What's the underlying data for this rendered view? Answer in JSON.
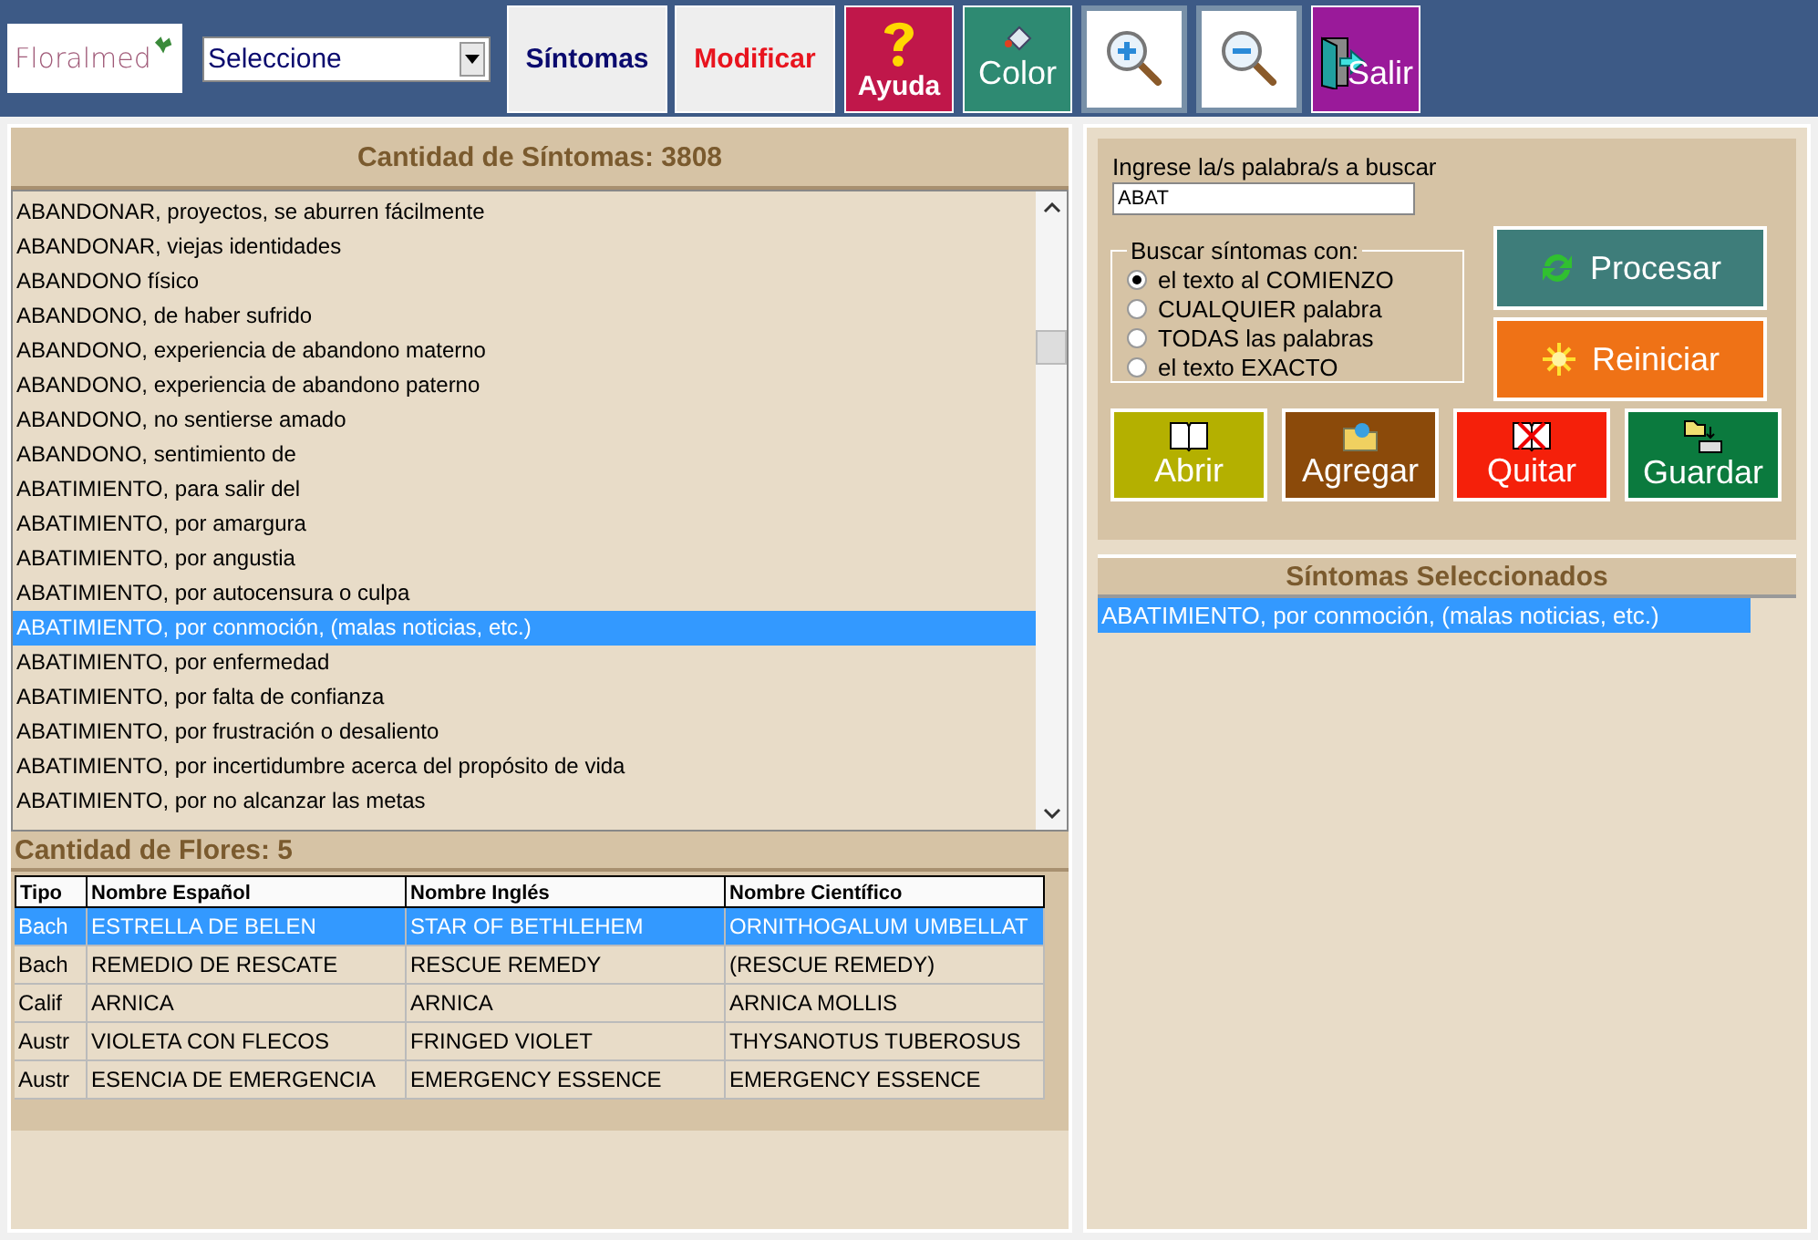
{
  "toolbar": {
    "logo": "Floralmed",
    "select": {
      "value": "Seleccione"
    },
    "buttons": [
      {
        "kind": "text",
        "label": "Síntomas",
        "color": "#0a0a6e"
      },
      {
        "kind": "text",
        "label": "Modificar",
        "color": "#e8141e"
      },
      {
        "kind": "help",
        "label": "Ayuda",
        "color": "#c0174a"
      },
      {
        "kind": "color",
        "label": "Color",
        "color": "#2e8a72"
      },
      {
        "kind": "zoom-in"
      },
      {
        "kind": "zoom-out"
      },
      {
        "kind": "exit",
        "label": "Salir",
        "color": "#9a1a9a"
      }
    ]
  },
  "symptoms": {
    "title": "Cantidad de Síntomas: 3808",
    "items": [
      {
        "text": "ABANDONAR, proyectos, se aburren fácilmente",
        "selected": false
      },
      {
        "text": "ABANDONAR, viejas identidades",
        "selected": false
      },
      {
        "text": "ABANDONO físico",
        "selected": false
      },
      {
        "text": "ABANDONO, de haber sufrido",
        "selected": false
      },
      {
        "text": "ABANDONO, experiencia de abandono materno",
        "selected": false
      },
      {
        "text": "ABANDONO, experiencia de abandono paterno",
        "selected": false
      },
      {
        "text": "ABANDONO, no sentierse amado",
        "selected": false
      },
      {
        "text": "ABANDONO, sentimiento de",
        "selected": false
      },
      {
        "text": "ABATIMIENTO, para salir del",
        "selected": false
      },
      {
        "text": "ABATIMIENTO, por amargura",
        "selected": false
      },
      {
        "text": "ABATIMIENTO, por angustia",
        "selected": false
      },
      {
        "text": "ABATIMIENTO, por autocensura o culpa",
        "selected": false
      },
      {
        "text": "ABATIMIENTO, por conmoción, (malas noticias, etc.)",
        "selected": true
      },
      {
        "text": "ABATIMIENTO, por enfermedad",
        "selected": false
      },
      {
        "text": "ABATIMIENTO, por falta de confianza",
        "selected": false
      },
      {
        "text": "ABATIMIENTO, por frustración o desaliento",
        "selected": false
      },
      {
        "text": "ABATIMIENTO, por incertidumbre acerca del propósito de vida",
        "selected": false
      },
      {
        "text": "ABATIMIENTO, por no alcanzar las metas",
        "selected": false
      }
    ]
  },
  "flowers": {
    "title": "Cantidad de Flores: 5",
    "columns": [
      "Tipo",
      "Nombre Español",
      "Nombre Inglés",
      "Nombre Científico"
    ],
    "rows": [
      {
        "cells": [
          "Bach",
          "ESTRELLA DE BELEN",
          "STAR OF BETHLEHEM",
          "ORNITHOGALUM UMBELLAT"
        ],
        "selected": true
      },
      {
        "cells": [
          "Bach",
          "REMEDIO DE RESCATE",
          "RESCUE REMEDY",
          "(RESCUE REMEDY)"
        ],
        "selected": false
      },
      {
        "cells": [
          "Calif",
          "ARNICA",
          "ARNICA",
          "ARNICA MOLLIS"
        ],
        "selected": false
      },
      {
        "cells": [
          "Austr",
          "VIOLETA CON FLECOS",
          "FRINGED VIOLET",
          "THYSANOTUS TUBEROSUS"
        ],
        "selected": false
      },
      {
        "cells": [
          "Austr",
          "ESENCIA DE EMERGENCIA",
          "EMERGENCY ESSENCE",
          "EMERGENCY ESSENCE"
        ],
        "selected": false
      }
    ]
  },
  "search": {
    "label": "Ingrese la/s palabra/s a buscar",
    "value": "ABAT",
    "mode_group": {
      "title": "Buscar síntomas con:",
      "options": [
        {
          "label": "el texto al COMIENZO",
          "selected": true
        },
        {
          "label": "CUALQUIER palabra",
          "selected": false
        },
        {
          "label": "TODAS las palabras",
          "selected": false
        },
        {
          "label": "el texto EXACTO",
          "selected": false
        }
      ]
    },
    "side_buttons": [
      {
        "kind": "refresh",
        "label": "Procesar",
        "color": "#3e7d7a"
      },
      {
        "kind": "sun",
        "label": "Reiniciar",
        "color": "#ef7216"
      }
    ],
    "actions": [
      {
        "kind": "book",
        "label": "Abrir",
        "color": "#b4b000"
      },
      {
        "kind": "add",
        "label": "Agregar",
        "color": "#8b4a0a"
      },
      {
        "kind": "remove",
        "label": "Quitar",
        "color": "#f5200a"
      },
      {
        "kind": "save",
        "label": "Guardar",
        "color": "#0b7a3e"
      }
    ]
  },
  "selected_symptoms": {
    "title": "Síntomas Seleccionados",
    "items": [
      {
        "text": "ABATIMIENTO, por conmoción, (malas noticias, etc.)",
        "selected": true
      }
    ]
  }
}
